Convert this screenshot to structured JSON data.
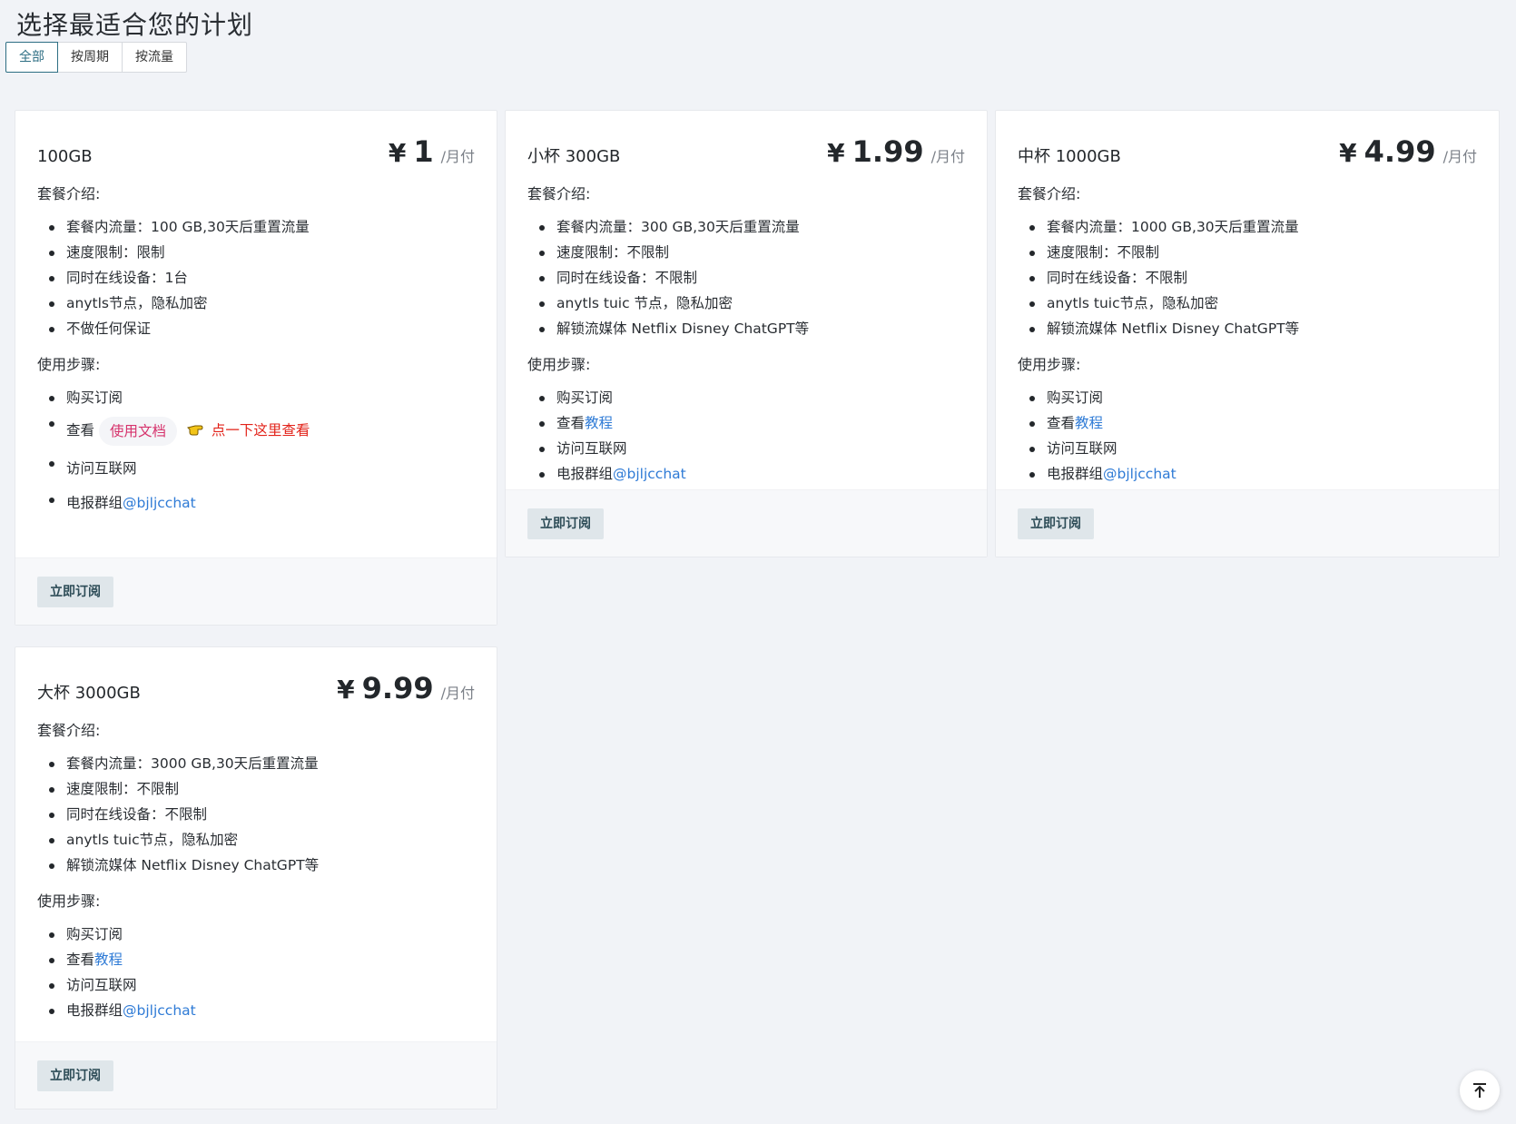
{
  "page": {
    "title": "选择最适合您的计划"
  },
  "tabs": [
    {
      "label": "全部",
      "active": true
    },
    {
      "label": "按周期",
      "active": false
    },
    {
      "label": "按流量",
      "active": false
    }
  ],
  "plans": [
    {
      "name": "100GB",
      "currency": "¥",
      "price": "1",
      "period": "/月付",
      "intro_label": "套餐介绍:",
      "features": [
        "套餐内流量：100 GB,30天后重置流量",
        "速度限制：限制",
        "同时在线设备：1台",
        "anytls节点，隐私加密",
        "不做任何保证"
      ],
      "steps_label": "使用步骤:",
      "steps": {
        "buy": "购买订阅",
        "view_prefix": "查看",
        "docs_pill": "使用文档",
        "hint": "点一下这里查看",
        "access": "访问互联网",
        "tg_prefix": "电报群组",
        "tg_link": "@bjljcchat"
      },
      "button": "立即订阅"
    },
    {
      "name": "小杯 300GB",
      "currency": "¥",
      "price": "1.99",
      "period": "/月付",
      "intro_label": "套餐介绍:",
      "features": [
        "套餐内流量：300 GB,30天后重置流量",
        "速度限制：不限制",
        "同时在线设备：不限制",
        "anytls tuic 节点，隐私加密",
        "解锁流媒体 Netflix Disney ChatGPT等"
      ],
      "steps_label": "使用步骤:",
      "steps": {
        "buy": "购买订阅",
        "view_prefix": "查看",
        "view_link": "教程",
        "access": "访问互联网",
        "tg_prefix": "电报群组",
        "tg_link": "@bjljcchat"
      },
      "button": "立即订阅"
    },
    {
      "name": "中杯 1000GB",
      "currency": "¥",
      "price": "4.99",
      "period": "/月付",
      "intro_label": "套餐介绍:",
      "features": [
        "套餐内流量：1000 GB,30天后重置流量",
        "速度限制：不限制",
        "同时在线设备：不限制",
        "anytls tuic节点，隐私加密",
        "解锁流媒体 Netflix Disney ChatGPT等"
      ],
      "steps_label": "使用步骤:",
      "steps": {
        "buy": "购买订阅",
        "view_prefix": "查看",
        "view_link": "教程",
        "access": "访问互联网",
        "tg_prefix": "电报群组",
        "tg_link": "@bjljcchat"
      },
      "button": "立即订阅"
    },
    {
      "name": "大杯 3000GB",
      "currency": "¥",
      "price": "9.99",
      "period": "/月付",
      "intro_label": "套餐介绍:",
      "features": [
        "套餐内流量：3000 GB,30天后重置流量",
        "速度限制：不限制",
        "同时在线设备：不限制",
        "anytls tuic节点，隐私加密",
        "解锁流媒体 Netflix Disney ChatGPT等"
      ],
      "steps_label": "使用步骤:",
      "steps": {
        "buy": "购买订阅",
        "view_prefix": "查看",
        "view_link": "教程",
        "access": "访问互联网",
        "tg_prefix": "电报群组",
        "tg_link": "@bjljcchat"
      },
      "button": "立即订阅"
    }
  ],
  "colors": {
    "accent": "#2d6e83",
    "link": "#2f7bd6",
    "hint": "#e2231a",
    "pill_text": "#d6336c"
  },
  "icons": {
    "back_to_top": "arrow-up-to-line-icon",
    "hand": "pointing-hand-icon"
  }
}
